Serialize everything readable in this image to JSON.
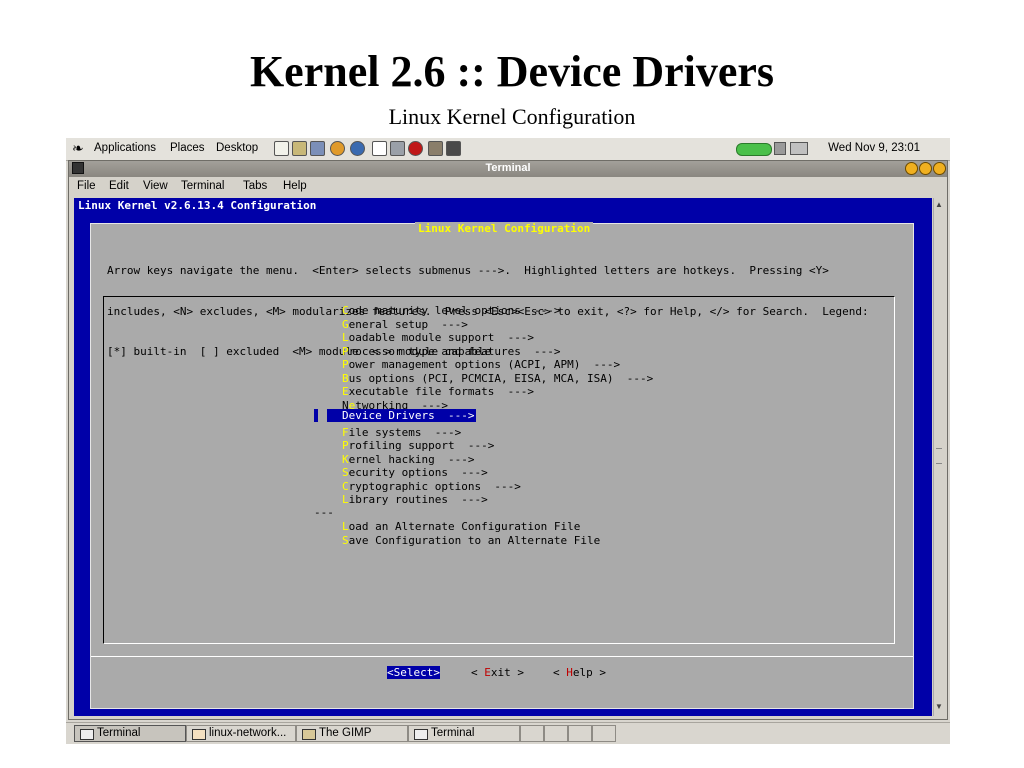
{
  "slide": {
    "title": "Kernel 2.6 :: Device Drivers",
    "subtitle": "Linux Kernel Configuration"
  },
  "panel": {
    "menus": [
      "Applications",
      "Places",
      "Desktop"
    ],
    "clock": "Wed Nov  9, 23:01"
  },
  "window": {
    "title": "Terminal",
    "menubar": [
      "File",
      "Edit",
      "View",
      "Terminal",
      "Tabs",
      "Help"
    ]
  },
  "terminal": {
    "header": "Linux Kernel v2.6.13.4 Configuration",
    "dialog_title": "Linux Kernel Configuration",
    "help_lines": [
      "Arrow keys navigate the menu.  <Enter> selects submenus --->.  Highlighted letters are hotkeys.  Pressing <Y>",
      "includes, <N> excludes, <M> modularizes features.  Press <Esc><Esc> to exit, <?> for Help, </> for Search.  Legend:",
      "[*] built-in  [ ] excluded  <M> module  < > module capable"
    ],
    "menu_items": [
      {
        "hotkey": "C",
        "rest": "ode maturity level options  --->"
      },
      {
        "hotkey": "G",
        "rest": "eneral setup  --->"
      },
      {
        "hotkey": "L",
        "rest": "oadable module support  --->"
      },
      {
        "hotkey": "P",
        "rest": "rocessor type and features  --->"
      },
      {
        "hotkey": "P",
        "rest": "ower management options (ACPI, APM)  --->"
      },
      {
        "hotkey": "B",
        "rest": "us options (PCI, PCMCIA, EISA, MCA, ISA)  --->"
      },
      {
        "hotkey": "E",
        "rest": "xecutable file formats  --->"
      },
      {
        "prefix": "N",
        "hotkey": "e",
        "rest": "tworking  --->"
      },
      {
        "hotkey": "D",
        "rest": "evice Drivers  --->",
        "selected": true
      },
      {
        "hotkey": "F",
        "rest": "ile systems  --->"
      },
      {
        "hotkey": "P",
        "rest": "rofiling support  --->"
      },
      {
        "hotkey": "K",
        "rest": "ernel hacking  --->"
      },
      {
        "hotkey": "S",
        "rest": "ecurity options  --->"
      },
      {
        "hotkey": "C",
        "rest": "ryptographic options  --->"
      },
      {
        "hotkey": "L",
        "rest": "ibrary routines  --->"
      }
    ],
    "separator": "---",
    "extra_items": [
      {
        "hotkey": "L",
        "rest": "oad an Alternate Configuration File"
      },
      {
        "hotkey": "S",
        "rest": "ave Configuration to an Alternate File"
      }
    ],
    "buttons": {
      "select": "<Select>",
      "exit_pre": "< ",
      "exit_hotkey": "E",
      "exit_rest": "xit >",
      "help_pre": "< ",
      "help_hotkey": "H",
      "help_rest": "elp >"
    }
  },
  "taskbar": {
    "tasks": [
      "Terminal",
      "linux-network...",
      "The GIMP",
      "Terminal"
    ]
  }
}
